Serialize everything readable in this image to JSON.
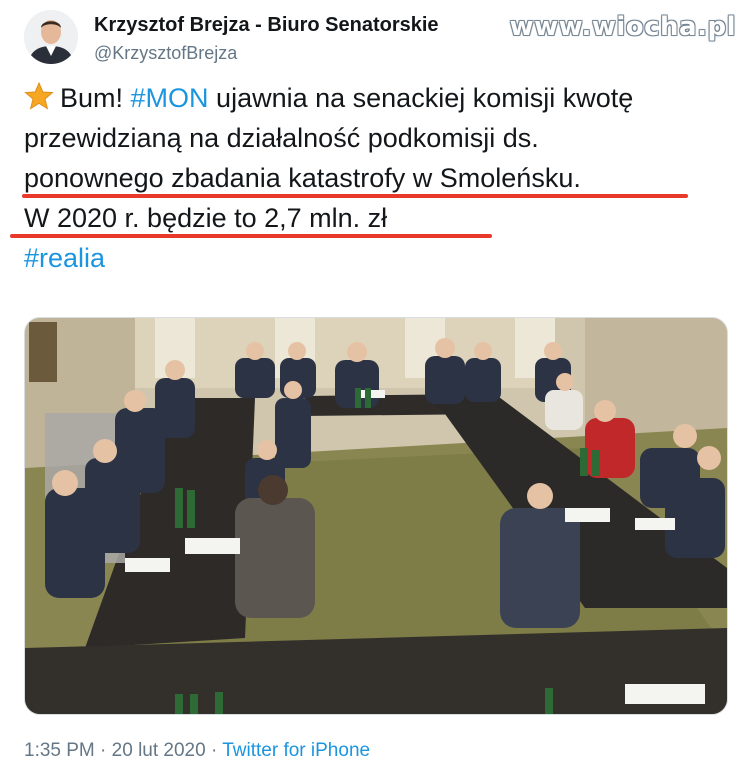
{
  "watermark": "www.wiocha.pl",
  "author": {
    "display_name": "Krzysztof Brejza - Biuro Senatorskie",
    "handle": "@KrzysztofBrejza",
    "avatar_icon": "profile-photo"
  },
  "tweet": {
    "lines": [
      {
        "parts": [
          {
            "type": "text",
            "value": "Bum! "
          },
          {
            "type": "hashtag",
            "value": "#MON"
          },
          {
            "type": "text",
            "value": " ujawnia na senackiej komisji kwotę"
          }
        ]
      },
      {
        "parts": [
          {
            "type": "text",
            "value": "przewidzianą na działalność podkomisji ds."
          }
        ]
      },
      {
        "parts": [
          {
            "type": "text",
            "value": "ponownego zbadania katastrofy w Smoleńsku."
          }
        ]
      },
      {
        "parts": [
          {
            "type": "text",
            "value": "W 2020 r. będzie to 2,7 mln. zł"
          }
        ]
      },
      {
        "parts": [
          {
            "type": "hashtag",
            "value": "#realia"
          }
        ]
      }
    ],
    "leading_icon": "star-emoji",
    "highlight_color": "#e8392b",
    "hashtag_color": "#1b95e0"
  },
  "media": {
    "description_icon": "senate-committee-meeting-photo"
  },
  "meta": {
    "time": "1:35 PM",
    "separator": " · ",
    "date": "20 lut 2020",
    "source": "Twitter for iPhone"
  }
}
